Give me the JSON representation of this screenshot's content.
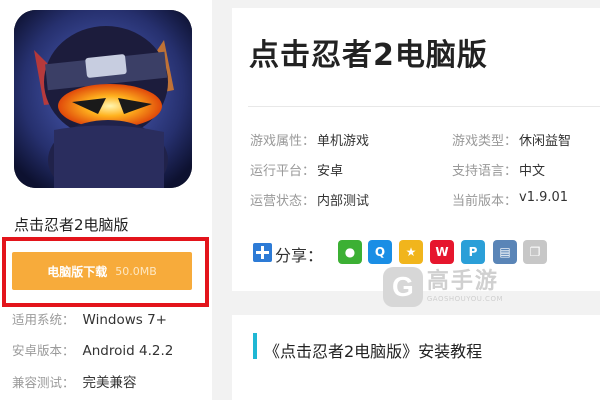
{
  "left": {
    "app_name": "点击忍者2电脑版",
    "download": {
      "label": "电脑版下载",
      "size": "50.0MB"
    },
    "specs": [
      {
        "label": "适用系统：",
        "value": "Windows 7+"
      },
      {
        "label": "安卓版本：",
        "value": "Android 4.2.2"
      },
      {
        "label": "兼容测试：",
        "value": "完美兼容"
      }
    ]
  },
  "info": {
    "title": "点击忍者2电脑版",
    "attributes": [
      {
        "label": "游戏属性：",
        "value": "单机游戏"
      },
      {
        "label": "游戏类型：",
        "value": "休闲益智"
      },
      {
        "label": "运行平台：",
        "value": "安卓"
      },
      {
        "label": "支持语言：",
        "value": "中文"
      },
      {
        "label": "运营状态：",
        "value": "内部测试"
      },
      {
        "label": "当前版本：",
        "value": "v1.9.01"
      }
    ],
    "share_label": "分享：",
    "share_icons": [
      {
        "name": "wechat-icon",
        "glyph": "●",
        "color": "#3cb034"
      },
      {
        "name": "qq-icon",
        "glyph": "Q",
        "color": "#1a8ee5"
      },
      {
        "name": "qzone-icon",
        "glyph": "★",
        "color": "#f1b51c"
      },
      {
        "name": "weibo-icon",
        "glyph": "W",
        "color": "#e6162d"
      },
      {
        "name": "tencent-weibo-icon",
        "glyph": "P",
        "color": "#2b9fd8"
      },
      {
        "name": "print-icon",
        "glyph": "▤",
        "color": "#5a85b7"
      },
      {
        "name": "copy-icon",
        "glyph": "❐",
        "color": "#c7c7c7"
      }
    ]
  },
  "watermark": {
    "symbol": "G",
    "text": "高手游",
    "subtext": "GAOSHOUYOU.COM"
  },
  "tutorial": {
    "title": "《点击忍者2电脑版》安装教程"
  }
}
